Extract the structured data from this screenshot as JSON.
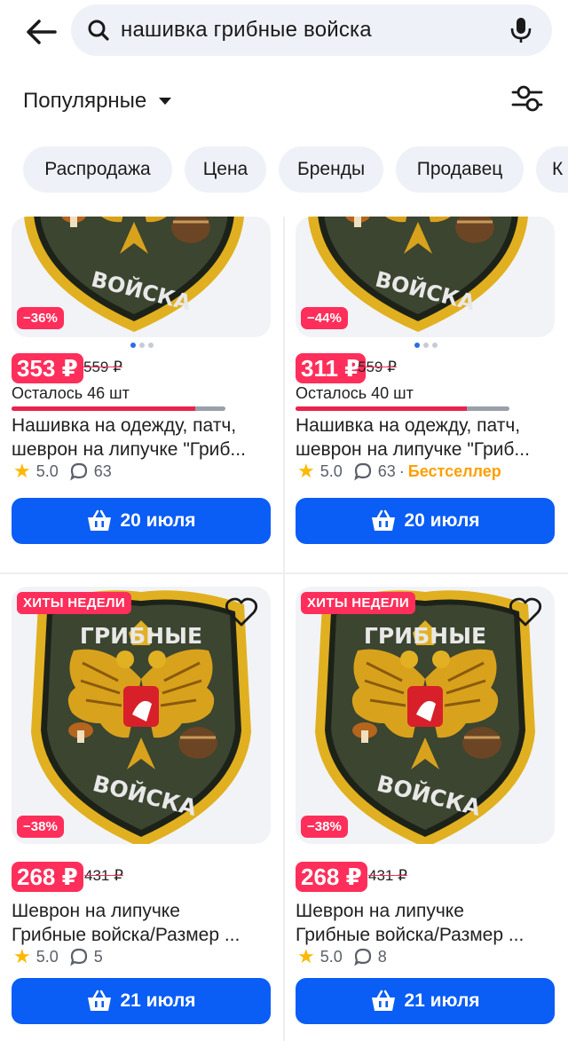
{
  "search": {
    "query": "нашивка грибные войска"
  },
  "sort": {
    "label": "Популярные"
  },
  "chips": [
    "Распродажа",
    "Цена",
    "Бренды",
    "Продавец",
    "К"
  ],
  "colors": {
    "accent": "#0a5df5",
    "sale": "#ff2e5a",
    "bestseller": "#ff9f00",
    "rating": "#ffb800"
  },
  "products": [
    {
      "discount": "−36%",
      "price": "353 ₽",
      "old_price": "559 ₽",
      "stock_left": "Осталось 46 шт",
      "stock_fraction": 0.86,
      "title_line1": "Нашивка на одежду, патч,",
      "title_line2": "шеврон на липучке \"Гриб...",
      "rating": "5.0",
      "reviews": "63",
      "cart_label": "20 июля"
    },
    {
      "discount": "−44%",
      "price": "311 ₽",
      "old_price": "559 ₽",
      "stock_left": "Осталось 40 шт",
      "stock_fraction": 0.8,
      "title_line1": "Нашивка на одежду, патч,",
      "title_line2": "шеврон на липучке \"Гриб...",
      "rating": "5.0",
      "reviews": "63",
      "badge": "Бестселлер",
      "cart_label": "20 июля"
    },
    {
      "hit_label": "ХИТЫ НЕДЕЛИ",
      "discount": "−38%",
      "price": "268 ₽",
      "old_price": "431 ₽",
      "title_line1": "Шеврон на липучке",
      "title_line2": "Грибные войска/Размер ...",
      "rating": "5.0",
      "reviews": "5",
      "cart_label": "21 июля",
      "patch_text_top": "ГРИБНЫЕ",
      "patch_text_bottom": "ВОЙСКА"
    },
    {
      "hit_label": "ХИТЫ НЕДЕЛИ",
      "discount": "−38%",
      "price": "268 ₽",
      "old_price": "431 ₽",
      "title_line1": "Шеврон на липучке",
      "title_line2": "Грибные войска/Размер ...",
      "rating": "5.0",
      "reviews": "8",
      "cart_label": "21 июля",
      "patch_text_top": "ГРИБНЫЕ",
      "patch_text_bottom": "ВОЙСКА"
    }
  ]
}
